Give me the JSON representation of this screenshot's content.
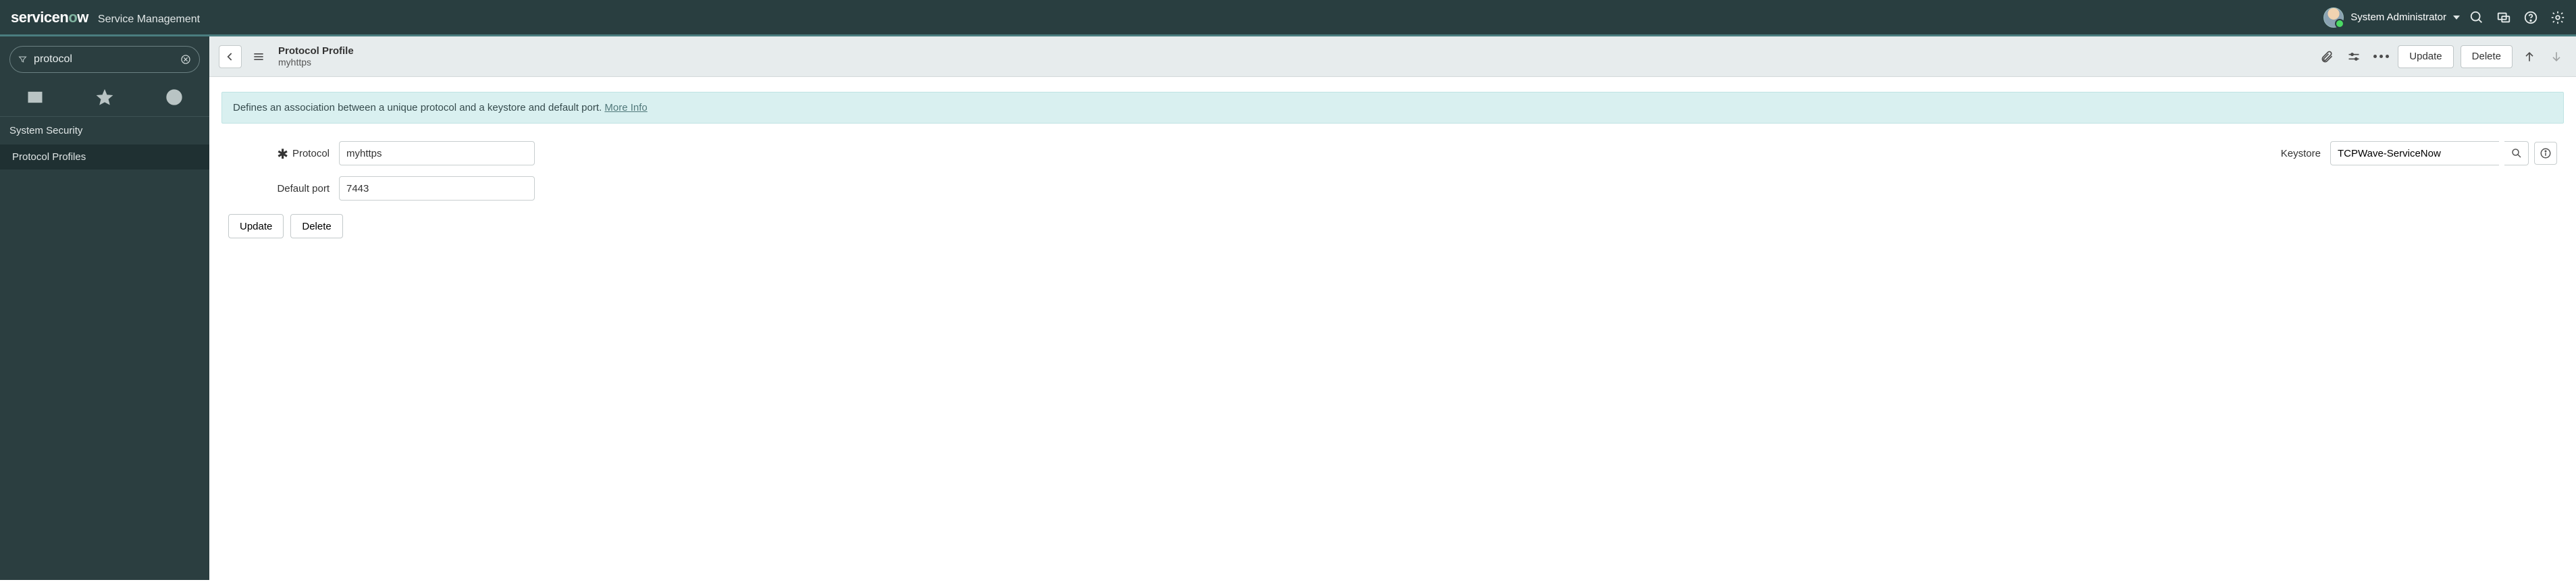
{
  "banner": {
    "product_a": "service",
    "product_b": "n",
    "product_c": "o",
    "product_d": "w",
    "suffix": "Service Management",
    "user_name": "System Administrator"
  },
  "leftnav": {
    "filter_value": "protocol",
    "section": "System Security",
    "item": "Protocol Profiles"
  },
  "header": {
    "title": "Protocol Profile",
    "subtitle": "myhttps",
    "update_label": "Update",
    "delete_label": "Delete"
  },
  "info": {
    "text": "Defines an association between a unique protocol and a keystore and default port. ",
    "link": "More Info"
  },
  "form": {
    "protocol_label": "Protocol",
    "protocol_value": "myhttps",
    "port_label": "Default port",
    "port_value": "7443",
    "keystore_label": "Keystore",
    "keystore_value": "TCPWave-ServiceNow",
    "actions": {
      "update": "Update",
      "delete": "Delete"
    }
  }
}
